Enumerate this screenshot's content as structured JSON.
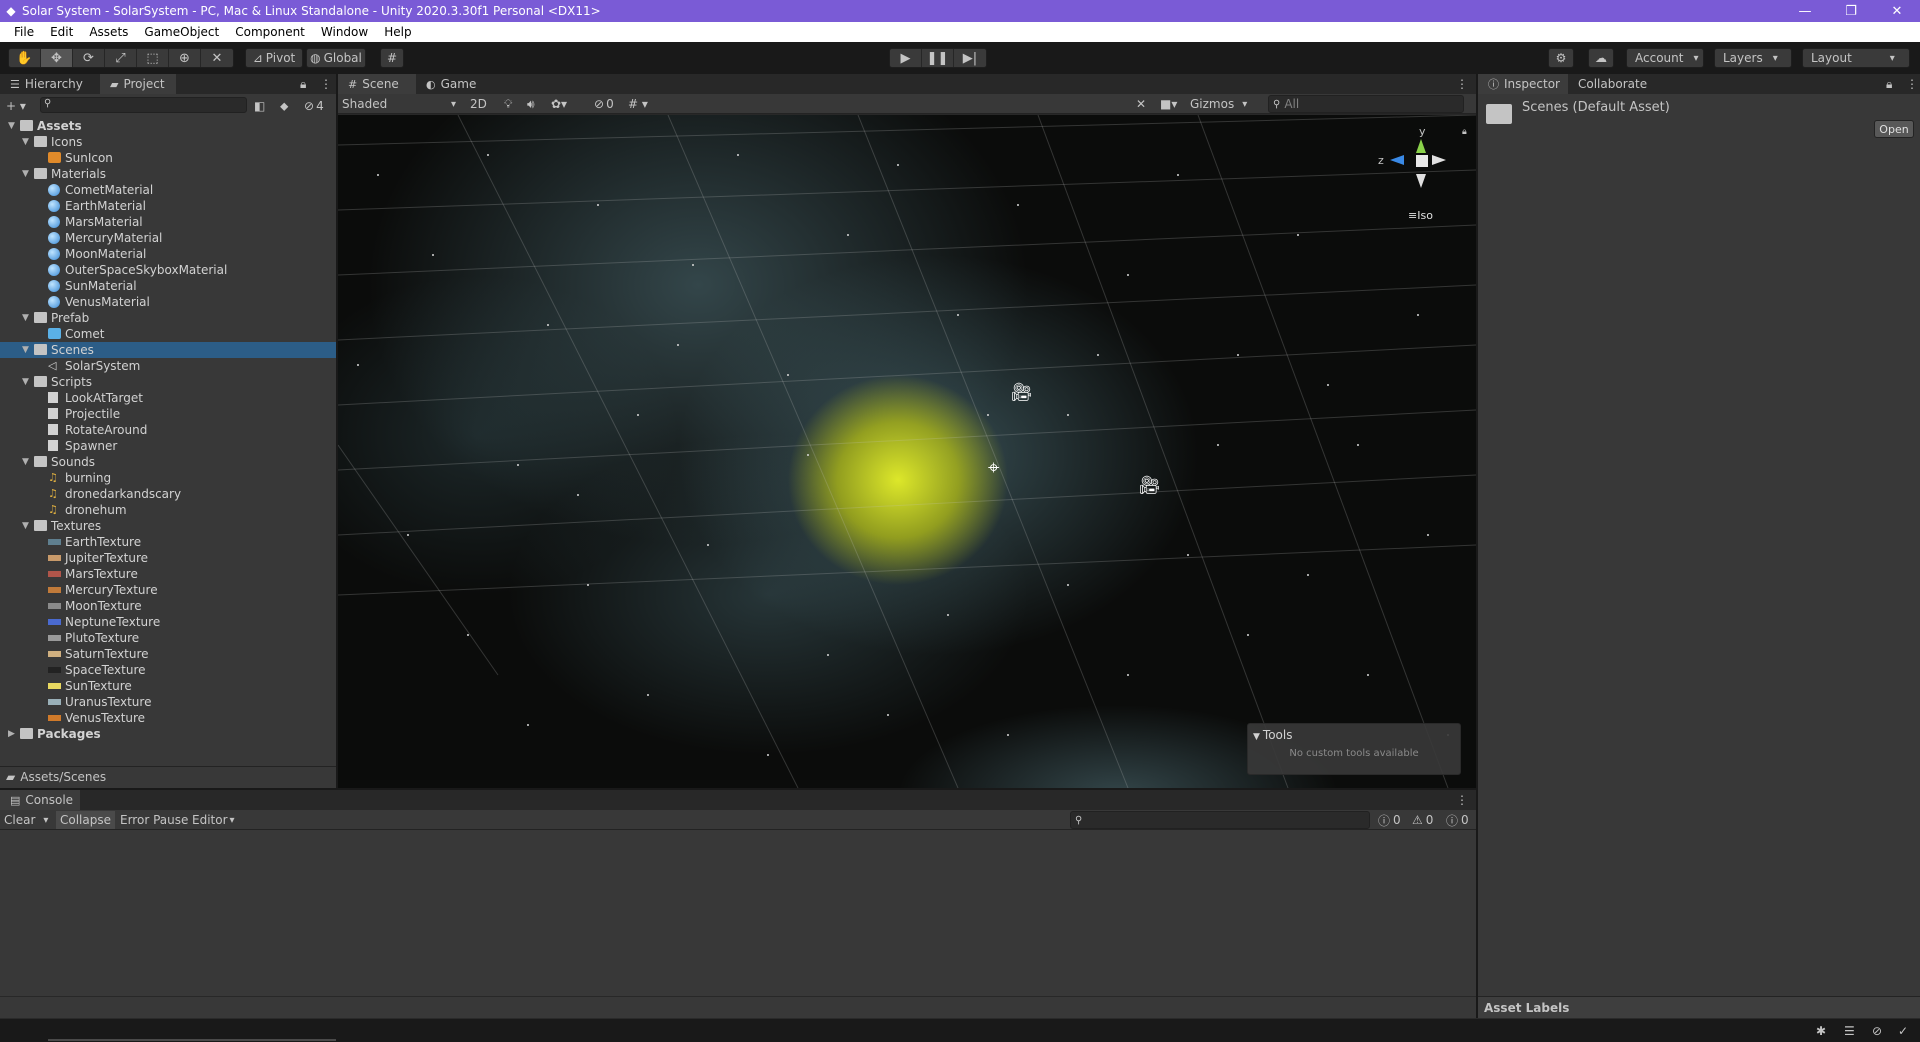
{
  "window": {
    "title": "Solar System - SolarSystem - PC, Mac & Linux Standalone - Unity 2020.3.30f1 Personal <DX11>",
    "accent": "#7a5bd6"
  },
  "menu": [
    "File",
    "Edit",
    "Assets",
    "GameObject",
    "Component",
    "Window",
    "Help"
  ],
  "toolbar": {
    "pivot": "Pivot",
    "global": "Global",
    "account": "Account",
    "layers": "Layers",
    "layout": "Layout"
  },
  "left_panel": {
    "tabs": [
      "Hierarchy",
      "Project"
    ],
    "active_tab": "Project",
    "hidden_count": "4",
    "search_placeholder": "",
    "tree": [
      {
        "label": "Assets",
        "depth": 0,
        "type": "folder-open",
        "expanded": true,
        "bold": true
      },
      {
        "label": "Icons",
        "depth": 1,
        "type": "folder-open",
        "expanded": true
      },
      {
        "label": "SunIcon",
        "depth": 2,
        "type": "icon-asset"
      },
      {
        "label": "Materials",
        "depth": 1,
        "type": "folder-open",
        "expanded": true
      },
      {
        "label": "CometMaterial",
        "depth": 2,
        "type": "material"
      },
      {
        "label": "EarthMaterial",
        "depth": 2,
        "type": "material"
      },
      {
        "label": "MarsMaterial",
        "depth": 2,
        "type": "material"
      },
      {
        "label": "MercuryMaterial",
        "depth": 2,
        "type": "material"
      },
      {
        "label": "MoonMaterial",
        "depth": 2,
        "type": "material"
      },
      {
        "label": "OuterSpaceSkyboxMaterial",
        "depth": 2,
        "type": "material"
      },
      {
        "label": "SunMaterial",
        "depth": 2,
        "type": "material"
      },
      {
        "label": "VenusMaterial",
        "depth": 2,
        "type": "material"
      },
      {
        "label": "Prefab",
        "depth": 1,
        "type": "folder-open",
        "expanded": true
      },
      {
        "label": "Comet",
        "depth": 2,
        "type": "prefab"
      },
      {
        "label": "Scenes",
        "depth": 1,
        "type": "folder-open",
        "expanded": true,
        "selected": true
      },
      {
        "label": "SolarSystem",
        "depth": 2,
        "type": "scene"
      },
      {
        "label": "Scripts",
        "depth": 1,
        "type": "folder-open",
        "expanded": true
      },
      {
        "label": "LookAtTarget",
        "depth": 2,
        "type": "script"
      },
      {
        "label": "Projectile",
        "depth": 2,
        "type": "script"
      },
      {
        "label": "RotateAround",
        "depth": 2,
        "type": "script"
      },
      {
        "label": "Spawner",
        "depth": 2,
        "type": "script"
      },
      {
        "label": "Sounds",
        "depth": 1,
        "type": "folder-open",
        "expanded": true
      },
      {
        "label": "burning",
        "depth": 2,
        "type": "audio"
      },
      {
        "label": "dronedarkandscary",
        "depth": 2,
        "type": "audio"
      },
      {
        "label": "dronehum",
        "depth": 2,
        "type": "audio"
      },
      {
        "label": "Textures",
        "depth": 1,
        "type": "folder-open",
        "expanded": true
      },
      {
        "label": "EarthTexture",
        "depth": 2,
        "type": "texture",
        "color": "#5f7f8f"
      },
      {
        "label": "JupiterTexture",
        "depth": 2,
        "type": "texture",
        "color": "#c89a6a"
      },
      {
        "label": "MarsTexture",
        "depth": 2,
        "type": "texture",
        "color": "#b0554a"
      },
      {
        "label": "MercuryTexture",
        "depth": 2,
        "type": "texture",
        "color": "#c07a3a"
      },
      {
        "label": "MoonTexture",
        "depth": 2,
        "type": "texture",
        "color": "#8a8a8a"
      },
      {
        "label": "NeptuneTexture",
        "depth": 2,
        "type": "texture",
        "color": "#4a6ad0"
      },
      {
        "label": "PlutoTexture",
        "depth": 2,
        "type": "texture",
        "color": "#9a9a9a"
      },
      {
        "label": "SaturnTexture",
        "depth": 2,
        "type": "texture",
        "color": "#d0b080"
      },
      {
        "label": "SpaceTexture",
        "depth": 2,
        "type": "texture",
        "color": "#222222"
      },
      {
        "label": "SunTexture",
        "depth": 2,
        "type": "texture",
        "color": "#e8d860"
      },
      {
        "label": "UranusTexture",
        "depth": 2,
        "type": "texture",
        "color": "#9ab0b8"
      },
      {
        "label": "VenusTexture",
        "depth": 2,
        "type": "texture",
        "color": "#d07a2a"
      },
      {
        "label": "Packages",
        "depth": 0,
        "type": "folder",
        "expanded": false,
        "bold": true
      }
    ],
    "path": "Assets/Scenes"
  },
  "scene_panel": {
    "tabs": [
      "Scene",
      "Game"
    ],
    "active_tab": "Scene",
    "shading": "Shaded",
    "mode_2d": "2D",
    "hidden_objects": "0",
    "gizmos": "Gizmos",
    "search_placeholder": "All",
    "axis_y": "y",
    "axis_z": "z",
    "projection": "Iso",
    "tools_title": "Tools",
    "tools_message": "No custom tools available"
  },
  "inspector": {
    "tabs": [
      "Inspector",
      "Collaborate"
    ],
    "asset_title": "Scenes (Default Asset)",
    "open_button": "Open",
    "asset_labels": "Asset Labels"
  },
  "console": {
    "tab": "Console",
    "clear": "Clear",
    "collapse": "Collapse",
    "error_pause": "Error Pause",
    "editor": "Editor",
    "count_info": "0",
    "count_warn": "0",
    "count_error": "0"
  }
}
